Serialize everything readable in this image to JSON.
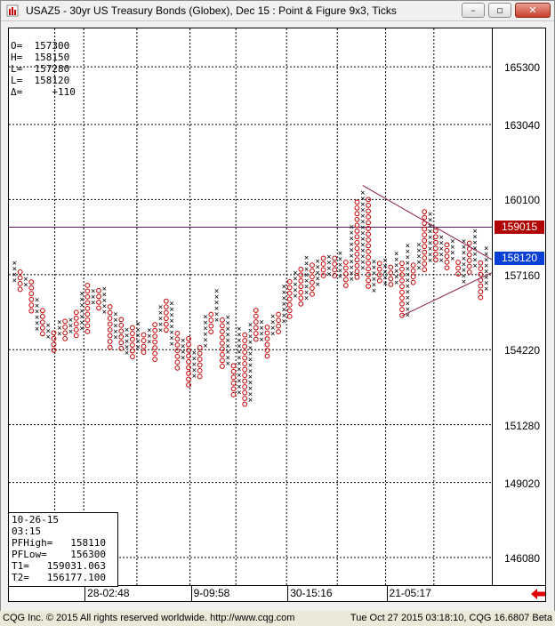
{
  "window": {
    "title": "USAZ5 - 30yr US Treasury Bonds (Globex), Dec 15 : Point & Figure 9x3, Ticks",
    "buttons": {
      "minimize": "–",
      "restore": "▫",
      "close": "✕"
    }
  },
  "ohlc": {
    "o": "O=  157300",
    "h": "H=  158150",
    "l1": "L=  157280",
    "l2": "L=  158120",
    "delta": "Δ=     +110"
  },
  "info_box": {
    "date": "10-26-15",
    "time": "03:15",
    "pfhigh": "PFHigh=   158110",
    "pflow": "PFLow=    156300",
    "t1": "T1=   159031.063",
    "t2": "T2=   156177.100"
  },
  "price_tags": {
    "last": "159015",
    "current": "158120",
    "colors": {
      "last": "#b00000",
      "current": "#0a3fd6"
    }
  },
  "status": {
    "left": "CQG Inc. © 2015 All rights reserved worldwide. http://www.cqg.com",
    "right": "Tue Oct 27 2015 03:18:10, CQG 16.6807 Beta"
  },
  "chart_data": {
    "type": "scatter",
    "subtype": "point-and-figure",
    "title": "USAZ5 - 30yr US Treasury Bonds (Globex), Dec 15 : Point & Figure 9x3, Ticks",
    "y_ticks": [
      "165300",
      "163040",
      "160100",
      "157160",
      "154220",
      "151280",
      "149020",
      "146080"
    ],
    "x_ticks": [
      "28-02:48",
      "9-09:58",
      "30-15:16",
      "21-05:17"
    ],
    "colors": {
      "x": "#000000",
      "o": "#cc0000",
      "hline": "#5a1a5a",
      "trend": "#8b1a4a"
    },
    "hline": 159015,
    "columns": [
      {
        "type": "X",
        "top": 157620,
        "bottom": 156950
      },
      {
        "type": "O",
        "top": 157260,
        "bottom": 156680
      },
      {
        "type": "X",
        "top": 157000,
        "bottom": 156820
      },
      {
        "type": "O",
        "top": 156870,
        "bottom": 155840
      },
      {
        "type": "X",
        "top": 156180,
        "bottom": 155020
      },
      {
        "type": "O",
        "top": 155750,
        "bottom": 154950
      },
      {
        "type": "X",
        "top": 155180,
        "bottom": 154650
      },
      {
        "type": "O",
        "top": 154880,
        "bottom": 154210
      },
      {
        "type": "X",
        "top": 155300,
        "bottom": 154850
      },
      {
        "type": "O",
        "top": 155330,
        "bottom": 154560
      },
      {
        "type": "X",
        "top": 155400,
        "bottom": 154850
      },
      {
        "type": "O",
        "top": 155680,
        "bottom": 154780
      },
      {
        "type": "X",
        "top": 156430,
        "bottom": 155000
      },
      {
        "type": "O",
        "top": 156740,
        "bottom": 154940
      },
      {
        "type": "X",
        "top": 156520,
        "bottom": 156010
      },
      {
        "type": "O",
        "top": 156530,
        "bottom": 155800
      },
      {
        "type": "X",
        "top": 156610,
        "bottom": 155750
      },
      {
        "type": "O",
        "top": 155900,
        "bottom": 154400
      },
      {
        "type": "X",
        "top": 155620,
        "bottom": 154650
      },
      {
        "type": "O",
        "top": 155400,
        "bottom": 154350
      },
      {
        "type": "X",
        "top": 155020,
        "bottom": 154160
      },
      {
        "type": "O",
        "top": 155080,
        "bottom": 153870
      },
      {
        "type": "X",
        "top": 155230,
        "bottom": 154250
      },
      {
        "type": "O",
        "top": 154800,
        "bottom": 154220
      },
      {
        "type": "X",
        "top": 155000,
        "bottom": 154500
      },
      {
        "type": "O",
        "top": 155200,
        "bottom": 153870
      },
      {
        "type": "X",
        "top": 155900,
        "bottom": 154920
      },
      {
        "type": "O",
        "top": 156120,
        "bottom": 155030
      },
      {
        "type": "X",
        "top": 156040,
        "bottom": 154400
      },
      {
        "type": "O",
        "top": 154860,
        "bottom": 153540
      },
      {
        "type": "X",
        "top": 154600,
        "bottom": 153840
      },
      {
        "type": "O",
        "top": 154650,
        "bottom": 152800
      },
      {
        "type": "X",
        "top": 154100,
        "bottom": 153240
      },
      {
        "type": "O",
        "top": 154300,
        "bottom": 153240
      },
      {
        "type": "X",
        "top": 155510,
        "bottom": 154340
      },
      {
        "type": "O",
        "top": 155600,
        "bottom": 154830
      },
      {
        "type": "X",
        "top": 156520,
        "bottom": 155330
      },
      {
        "type": "O",
        "top": 155380,
        "bottom": 153540
      },
      {
        "type": "X",
        "top": 155500,
        "bottom": 153680
      },
      {
        "type": "O",
        "top": 153590,
        "bottom": 152380
      },
      {
        "type": "X",
        "top": 155050,
        "bottom": 152460
      },
      {
        "type": "O",
        "top": 154800,
        "bottom": 152000
      },
      {
        "type": "X",
        "top": 155200,
        "bottom": 152350
      },
      {
        "type": "O",
        "top": 155760,
        "bottom": 154660
      },
      {
        "type": "X",
        "top": 155300,
        "bottom": 154540
      },
      {
        "type": "O",
        "top": 155100,
        "bottom": 154030
      },
      {
        "type": "X",
        "top": 155530,
        "bottom": 154760
      },
      {
        "type": "O",
        "top": 155600,
        "bottom": 155000
      },
      {
        "type": "X",
        "top": 156700,
        "bottom": 155400
      },
      {
        "type": "O",
        "top": 156880,
        "bottom": 155450
      },
      {
        "type": "X",
        "top": 157240,
        "bottom": 156340
      },
      {
        "type": "O",
        "top": 157370,
        "bottom": 156100
      },
      {
        "type": "X",
        "top": 157830,
        "bottom": 156320
      },
      {
        "type": "O",
        "top": 157530,
        "bottom": 156460
      },
      {
        "type": "X",
        "top": 157700,
        "bottom": 156780
      },
      {
        "type": "O",
        "top": 157800,
        "bottom": 157060
      },
      {
        "type": "X",
        "top": 157870,
        "bottom": 157110
      },
      {
        "type": "O",
        "top": 157800,
        "bottom": 157100
      },
      {
        "type": "X",
        "top": 158000,
        "bottom": 157000
      },
      {
        "type": "O",
        "top": 157640,
        "bottom": 156800
      },
      {
        "type": "X",
        "top": 159040,
        "bottom": 157050
      },
      {
        "type": "O",
        "top": 160000,
        "bottom": 157120
      },
      {
        "type": "X",
        "top": 160380,
        "bottom": 157380
      },
      {
        "type": "O",
        "top": 160100,
        "bottom": 156620
      },
      {
        "type": "X",
        "top": 157680,
        "bottom": 156630
      },
      {
        "type": "O",
        "top": 157600,
        "bottom": 156820
      },
      {
        "type": "X",
        "top": 157720,
        "bottom": 156830
      },
      {
        "type": "O",
        "top": 157450,
        "bottom": 156750
      },
      {
        "type": "X",
        "top": 157990,
        "bottom": 156760
      },
      {
        "type": "O",
        "top": 157600,
        "bottom": 155450
      },
      {
        "type": "X",
        "top": 158310,
        "bottom": 155700
      },
      {
        "type": "O",
        "top": 157530,
        "bottom": 156820
      },
      {
        "type": "X",
        "top": 158340,
        "bottom": 157360
      },
      {
        "type": "O",
        "top": 159620,
        "bottom": 157440
      },
      {
        "type": "X",
        "top": 159540,
        "bottom": 157760
      },
      {
        "type": "O",
        "top": 158870,
        "bottom": 157790
      },
      {
        "type": "X",
        "top": 158630,
        "bottom": 157830
      },
      {
        "type": "O",
        "top": 158330,
        "bottom": 157510
      },
      {
        "type": "X",
        "top": 158470,
        "bottom": 157700
      },
      {
        "type": "O",
        "top": 157640,
        "bottom": 157150
      },
      {
        "type": "X",
        "top": 158480,
        "bottom": 157000
      },
      {
        "type": "O",
        "top": 158390,
        "bottom": 157180
      },
      {
        "type": "X",
        "top": 158880,
        "bottom": 157420
      },
      {
        "type": "O",
        "top": 157620,
        "bottom": 156220
      },
      {
        "type": "X",
        "top": 158200,
        "bottom": 156630
      }
    ],
    "ylim": [
      145000,
      166800
    ]
  }
}
